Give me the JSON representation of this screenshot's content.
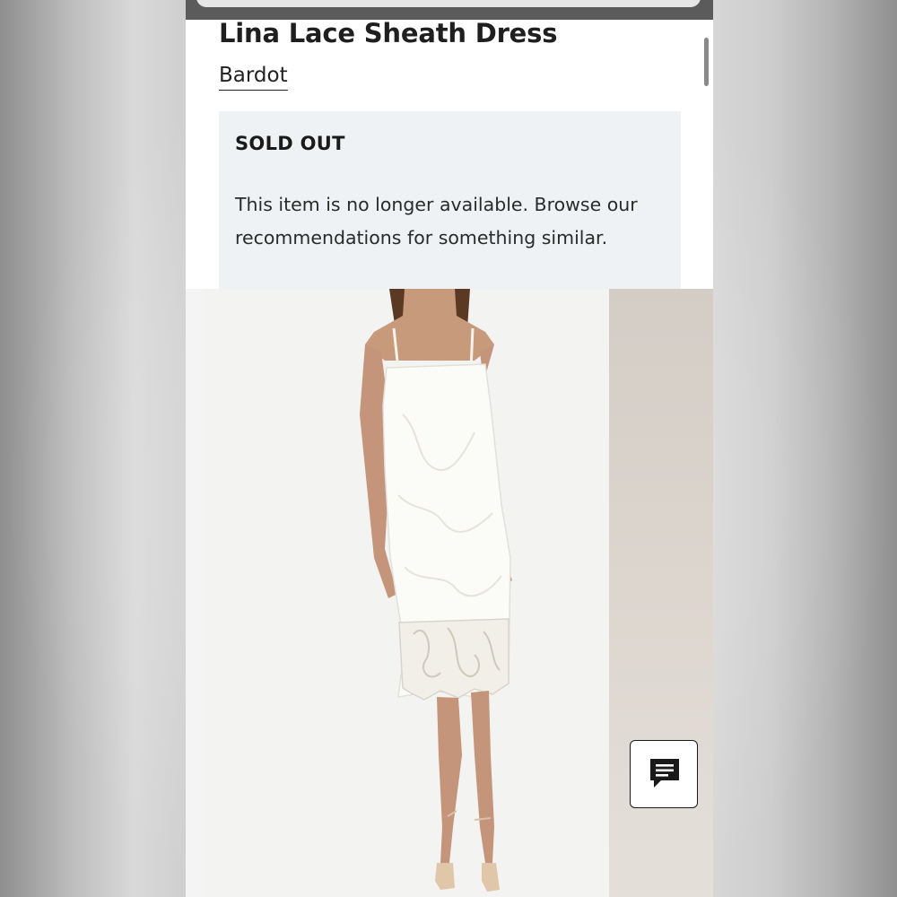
{
  "product": {
    "title": "Lina Lace Sheath Dress",
    "brand": "Bardot"
  },
  "availability": {
    "heading": "SOLD OUT",
    "message": "This item is no longer available. Browse our recommendations for something similar."
  },
  "gallery": {
    "main_image_icon": "model-wearing-white-lace-dress-image",
    "side_image_icon": "next-product-image-preview"
  },
  "chat": {
    "icon": "chat-bubble-icon"
  },
  "colors": {
    "soldout_background": "#eef2f5",
    "text": "#1f1f1f",
    "top_bar": "#5b5b5b"
  }
}
